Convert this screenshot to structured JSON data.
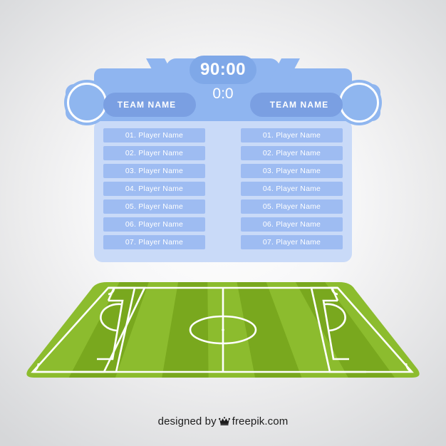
{
  "scoreboard": {
    "timer": "90:00",
    "score": "0:0",
    "team_left": {
      "name": "TEAM NAME",
      "badge_icon": "team-crest-circle-icon"
    },
    "team_right": {
      "name": "TEAM NAME",
      "badge_icon": "team-crest-circle-icon"
    },
    "roster_left": [
      "01. Player Name",
      "02. Player Name",
      "03. Player Name",
      "04. Player Name",
      "05. Player Name",
      "06. Player Name",
      "07. Player Name"
    ],
    "roster_right": [
      "01. Player Name",
      "02. Player Name",
      "03. Player Name",
      "04. Player Name",
      "05. Player Name",
      "06. Player Name",
      "07. Player Name"
    ]
  },
  "field": {
    "label": "soccer-pitch-perspective",
    "markings": [
      "halfway-line",
      "center-circle",
      "center-spot",
      "left-penalty-area",
      "left-goal-area",
      "left-penalty-arc",
      "left-goal",
      "right-penalty-area",
      "right-goal-area",
      "right-penalty-arc",
      "right-goal",
      "corner-arcs"
    ]
  },
  "footer": {
    "prefix": "designed by",
    "logo_icon": "freepik-crown-icon",
    "brand": "freepik.com"
  },
  "colors": {
    "background_center": "#ffffff",
    "background_edge": "#dcdddf",
    "banner_blue": "#8fb5f0",
    "timer_blue": "#7fa8e8",
    "team_pill_blue": "#7a9fe2",
    "panel_pale_blue": "#c9daf8",
    "player_row_blue": "#9ebcf2",
    "badge_blue": "#8fb6ef",
    "field_green_light": "#8cbc2e",
    "field_green_dark": "#79a81e",
    "field_line_white": "#ffffff",
    "text_white": "#ffffff",
    "footer_text": "#1d1d1d"
  }
}
